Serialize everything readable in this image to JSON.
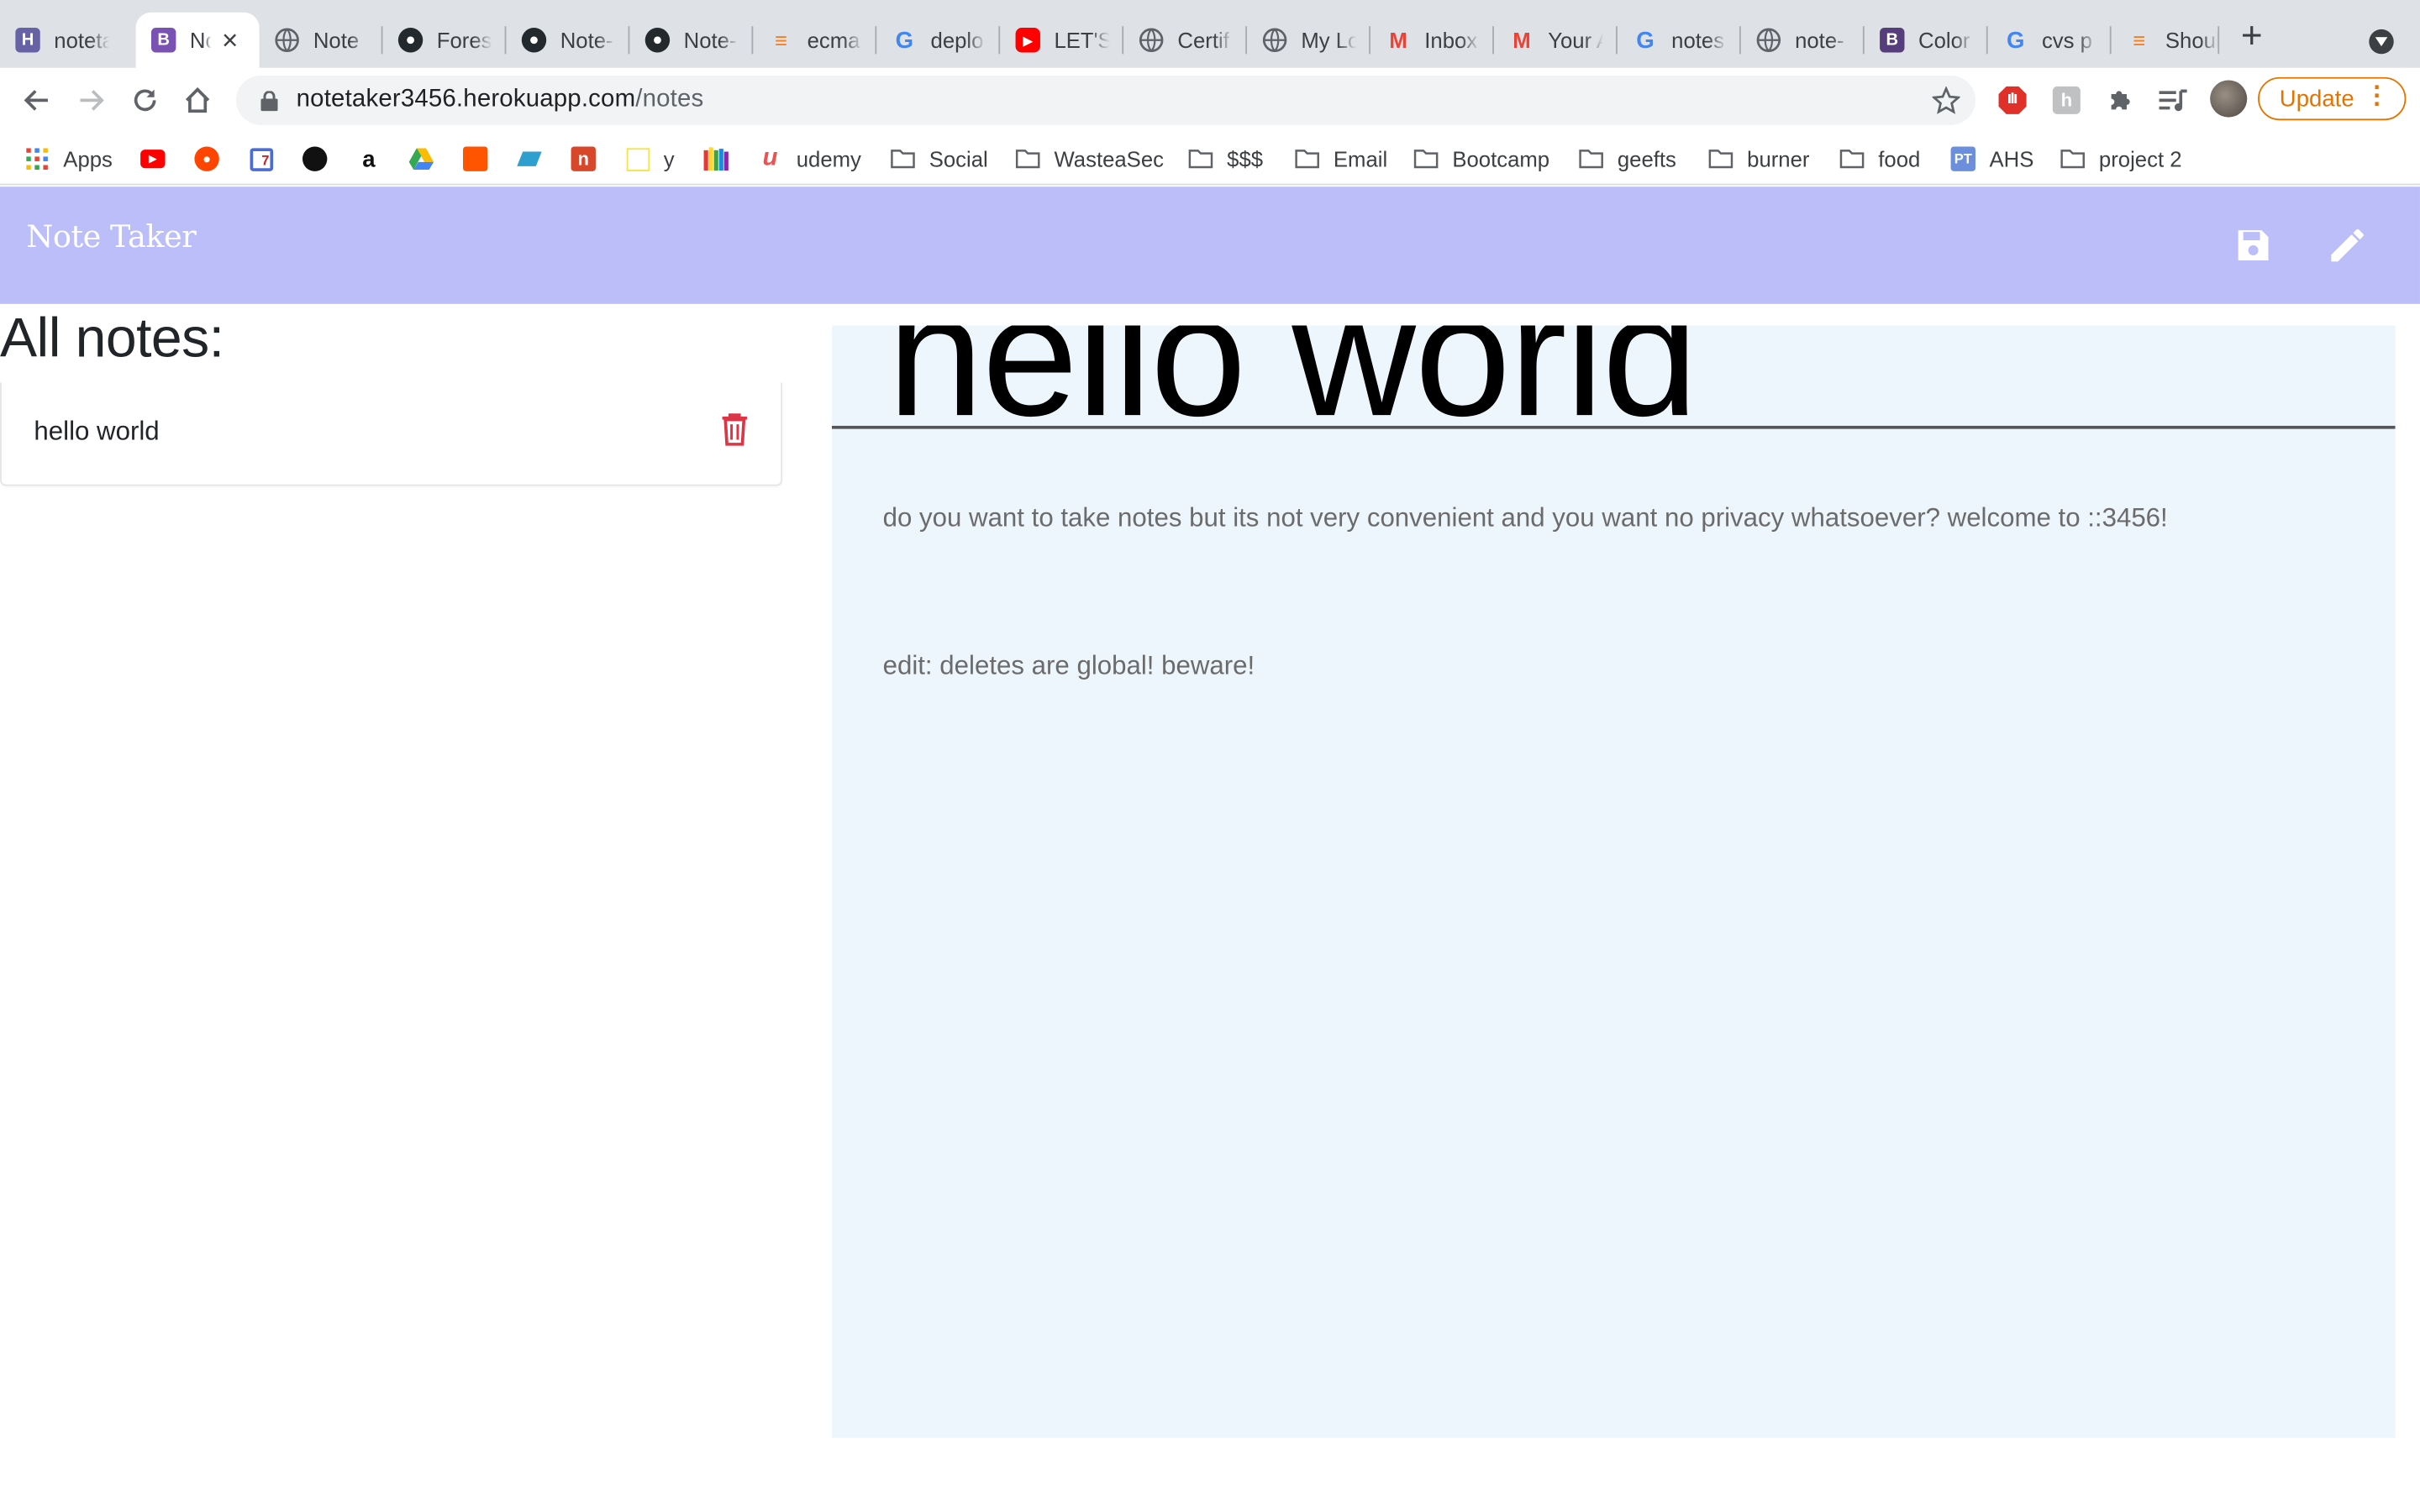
{
  "browser": {
    "tabs": [
      {
        "label": "noteta",
        "favicon": "heroku-icon",
        "color": "#6762a6"
      },
      {
        "label": "Nc",
        "favicon": "bootstrap-icon",
        "color": "#7952b3",
        "active": true
      },
      {
        "label": "Note",
        "favicon": "globe-icon"
      },
      {
        "label": "Forest",
        "favicon": "github-icon"
      },
      {
        "label": "Note-",
        "favicon": "github-icon"
      },
      {
        "label": "Note-",
        "favicon": "github-icon"
      },
      {
        "label": "ecma",
        "favicon": "stackoverflow-icon",
        "color": "#f48024"
      },
      {
        "label": "deplo",
        "favicon": "google-icon"
      },
      {
        "label": "LET'S",
        "favicon": "youtube-icon",
        "color": "#ff0000"
      },
      {
        "label": "Certif",
        "favicon": "globe-icon"
      },
      {
        "label": "My Lo",
        "favicon": "globe-icon"
      },
      {
        "label": "Inbox",
        "favicon": "gmail-icon"
      },
      {
        "label": "Your A",
        "favicon": "gmail-icon"
      },
      {
        "label": "notes",
        "favicon": "google-icon"
      },
      {
        "label": "note-",
        "favicon": "globe-icon"
      },
      {
        "label": "Color",
        "favicon": "bootstrap-icon",
        "color": "#563d7c"
      },
      {
        "label": "cvs p",
        "favicon": "google-icon"
      },
      {
        "label": "Shoul",
        "favicon": "stackoverflow-icon",
        "color": "#f48024"
      }
    ],
    "address": {
      "domain": "notetaker3456.herokuapp.com",
      "path": "/notes"
    },
    "update_label": "Update",
    "bookmarks": [
      {
        "label": "Apps",
        "icon": "apps-grid-icon"
      },
      {
        "label": "",
        "icon": "youtube-icon"
      },
      {
        "label": "",
        "icon": "reddit-icon"
      },
      {
        "label": "",
        "icon": "calendar-icon"
      },
      {
        "label": "",
        "icon": "circle-logo-icon"
      },
      {
        "label": "",
        "icon": "amazon-icon"
      },
      {
        "label": "",
        "icon": "google-drive-icon"
      },
      {
        "label": "",
        "icon": "soundcloud-icon"
      },
      {
        "label": "",
        "icon": "parallelogram-icon"
      },
      {
        "label": "",
        "icon": "n-logo-icon"
      },
      {
        "label": "y",
        "icon": "yellow-square-icon"
      },
      {
        "label": "",
        "icon": "books-icon"
      },
      {
        "label": "udemy",
        "icon": "udemy-icon"
      },
      {
        "label": "Social",
        "icon": "folder-icon"
      },
      {
        "label": "WasteaSec",
        "icon": "folder-icon"
      },
      {
        "label": "$$$",
        "icon": "folder-icon"
      },
      {
        "label": "Email",
        "icon": "folder-icon"
      },
      {
        "label": "Bootcamp",
        "icon": "folder-icon"
      },
      {
        "label": "geefts",
        "icon": "folder-icon"
      },
      {
        "label": "burner",
        "icon": "folder-icon"
      },
      {
        "label": "food",
        "icon": "folder-icon"
      },
      {
        "label": "AHS",
        "icon": "pt-logo-icon"
      },
      {
        "label": "project 2",
        "icon": "folder-icon"
      }
    ]
  },
  "app": {
    "brand": "Note Taker",
    "nav_color": "#bbbef8",
    "list_heading": "All notes:",
    "notes": [
      {
        "title": "hello world"
      }
    ],
    "active_note": {
      "title": "hello world",
      "text": "do you want to take notes but its not very convenient and you want no privacy whatsoever? welcome to ::3456!\n\nedit: deletes are global! beware!"
    },
    "icons": {
      "save": "save-icon",
      "new": "pencil-icon",
      "delete": "trash-icon",
      "delete_color": "#dc3545"
    }
  }
}
